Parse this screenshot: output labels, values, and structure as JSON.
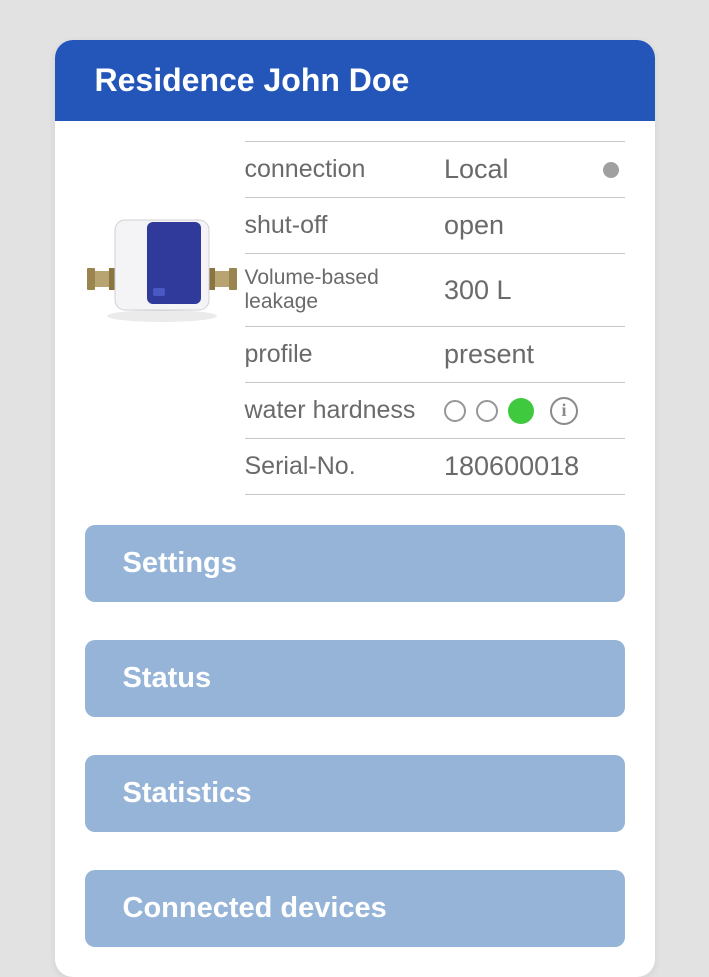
{
  "header": {
    "title": "Residence John Doe"
  },
  "device": {
    "image_alt": "leak-protection-device"
  },
  "info": {
    "connection": {
      "label": "connection",
      "value": "Local",
      "status": "offline"
    },
    "shutoff": {
      "label": "shut-off",
      "value": "open"
    },
    "leakage": {
      "label": "Volume-based leakage",
      "value": "300 L"
    },
    "profile": {
      "label": "profile",
      "value": "present"
    },
    "hardness": {
      "label": "water hardness",
      "levels": [
        "empty",
        "empty",
        "filled-green"
      ]
    },
    "serial": {
      "label": "Serial-No.",
      "value": "180600018"
    }
  },
  "menu": {
    "settings": "Settings",
    "status": "Status",
    "statistics": "Statistics",
    "connected": "Connected devices"
  }
}
